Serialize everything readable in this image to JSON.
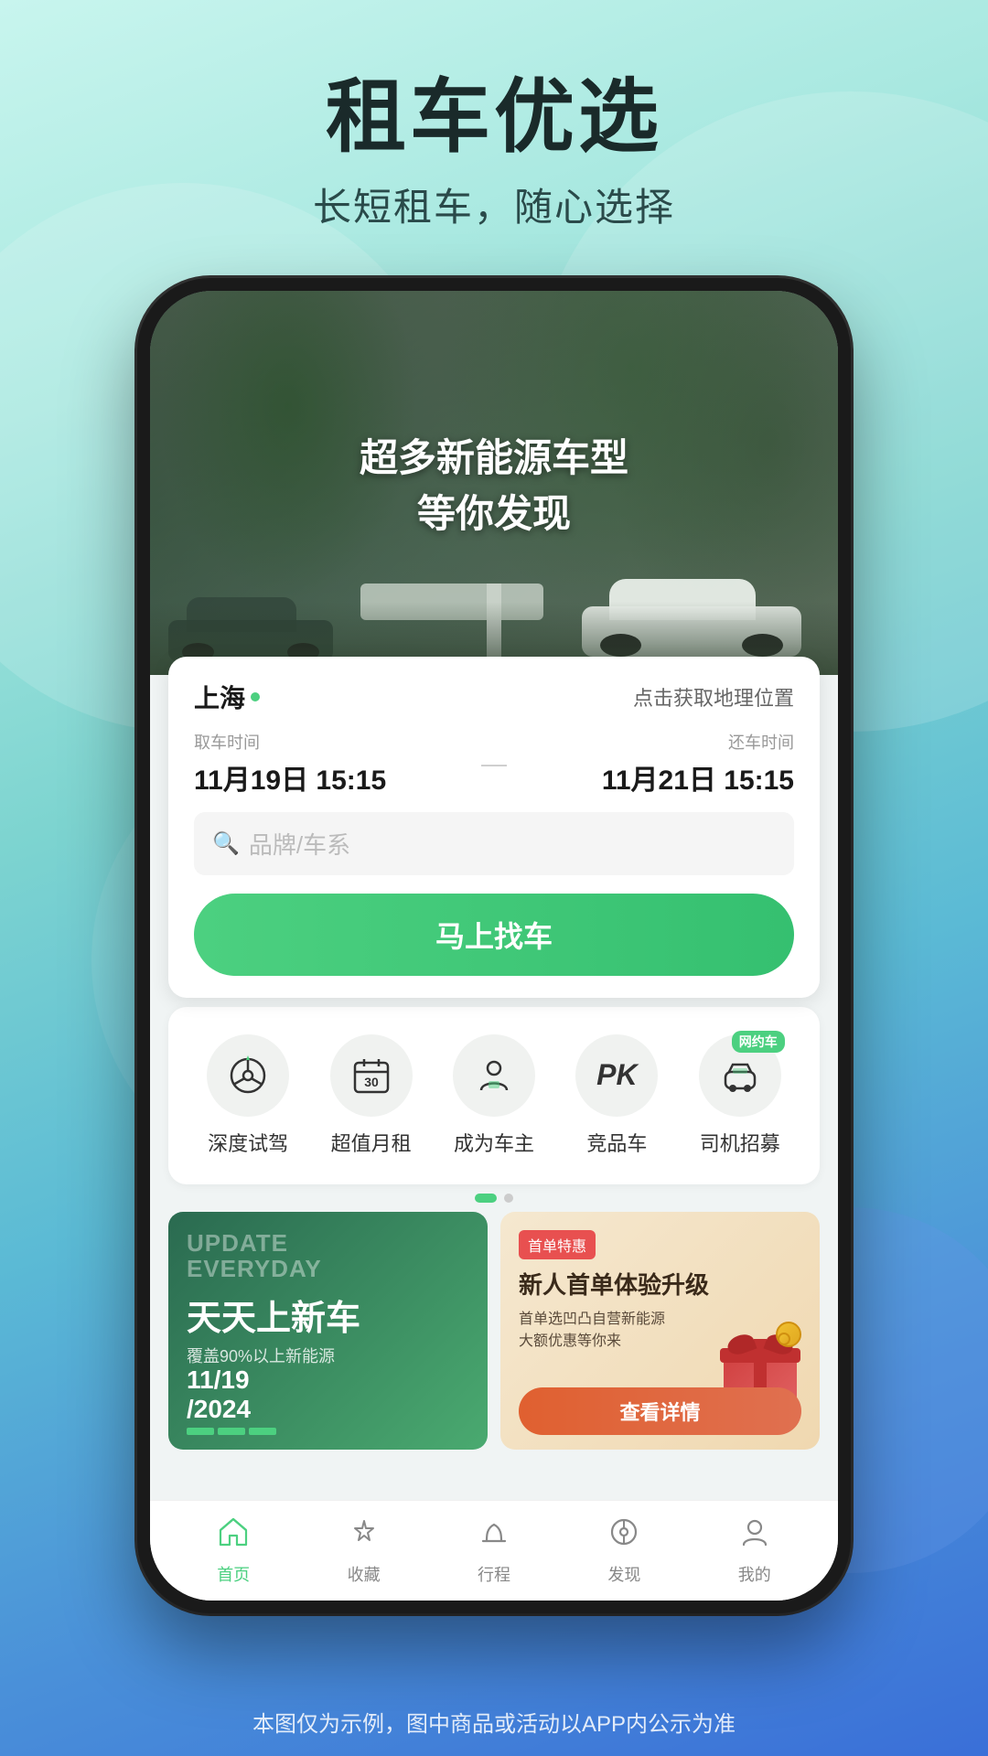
{
  "page": {
    "title": "租车优选",
    "subtitle": "长短租车，随心选择",
    "disclaimer": "本图仅为示例，图中商品或活动以APP内公示为准"
  },
  "hero": {
    "line1": "超多新能源车型",
    "line2": "等你发现"
  },
  "booking": {
    "location_name": "上海",
    "location_btn": "点击获取地理位置",
    "pickup_label": "取车时间",
    "pickup_date": "11月19日 15:15",
    "return_label": "还车时间",
    "return_date": "11月21日 15:15",
    "search_placeholder": "品牌/车系",
    "search_btn": "马上找车"
  },
  "quick_menu": {
    "items": [
      {
        "label": "深度试驾",
        "icon": "🎯"
      },
      {
        "label": "超值月租",
        "icon": "📅"
      },
      {
        "label": "成为车主",
        "icon": "👤"
      },
      {
        "label": "竞品车",
        "icon": "PK"
      },
      {
        "label": "司机招募",
        "icon": "🚗",
        "badge": "网约车"
      }
    ]
  },
  "banners": {
    "left": {
      "update_text": "UPDATE\nEVERYDAY",
      "main_text": "天天上新车",
      "sub_text": "覆盖90%以上新能源",
      "date": "11/19\n/2024"
    },
    "right": {
      "badge": "首单特惠",
      "title": "新人首单体验升级",
      "sub": "首单选凹凸自营新能源\n大额优惠等你来",
      "btn": "查看详情"
    }
  },
  "nav": {
    "items": [
      {
        "label": "首页",
        "active": true
      },
      {
        "label": "收藏",
        "active": false
      },
      {
        "label": "行程",
        "active": false
      },
      {
        "label": "发现",
        "active": false
      },
      {
        "label": "我的",
        "active": false
      }
    ]
  },
  "dots": {
    "active": 0,
    "total": 2
  }
}
